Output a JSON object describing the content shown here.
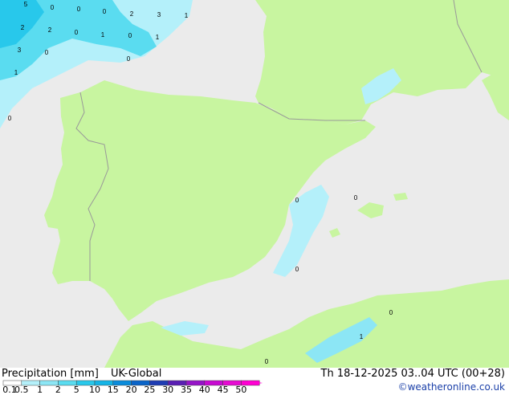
{
  "footer": {
    "title": "Precipitation [mm]",
    "model": "UK-Global",
    "valid_time": "Th 18-12-2025 03..04 UTC (00+28)",
    "credit": "©weatheronline.co.uk"
  },
  "legend": {
    "ticks": [
      "0.1",
      "0.5",
      "1",
      "2",
      "5",
      "10",
      "15",
      "20",
      "25",
      "30",
      "35",
      "40",
      "45",
      "50"
    ],
    "colors": [
      "#ffffff",
      "#b4f0fa",
      "#8ce6f5",
      "#5adcf0",
      "#28c8eb",
      "#14b4e6",
      "#0a8cdc",
      "#0a64c8",
      "#1e3cb4",
      "#5a1eb4",
      "#9614c8",
      "#c80ad2",
      "#e60ad2",
      "#ff00d2"
    ]
  },
  "map": {
    "land_color": "#c8f5a0",
    "sea_color": "#ebebeb",
    "border_color": "#999999",
    "labels": [
      "5",
      "0",
      "0",
      "0",
      "2",
      "3",
      "1",
      "2",
      "2",
      "0",
      "1",
      "0",
      "1",
      "3",
      "0",
      "0",
      "1",
      "0",
      "0",
      "0",
      "0",
      "0",
      "1",
      "0"
    ]
  }
}
